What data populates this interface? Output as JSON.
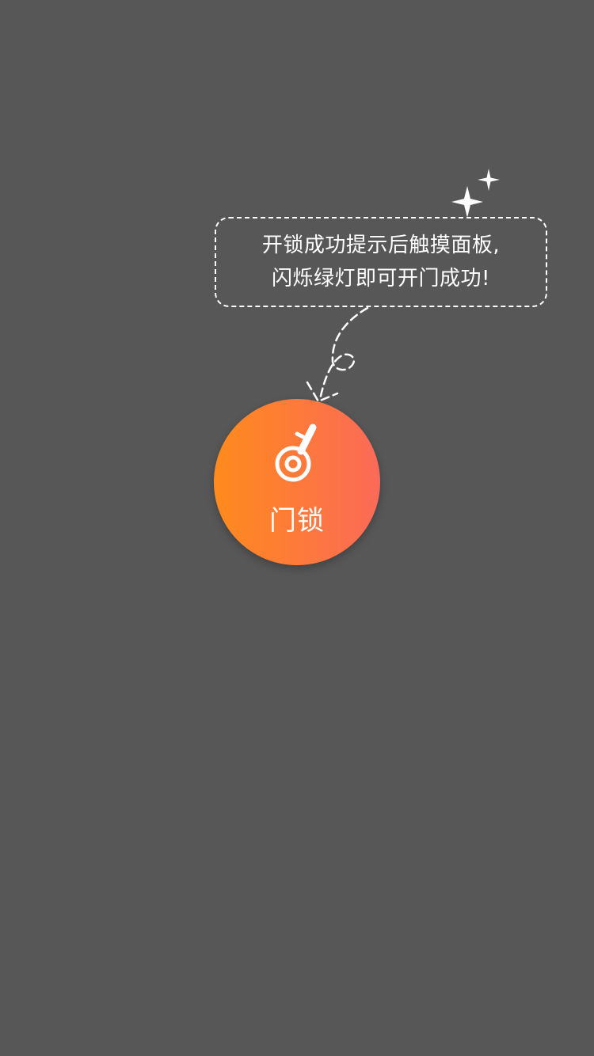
{
  "tip": {
    "line1": "开锁成功提示后触摸面板,",
    "line2": "闪烁绿灯即可开门成功!"
  },
  "lock_button": {
    "label": "门锁",
    "icon": "key-icon",
    "gradient_start": "#ff8a1c",
    "gradient_end": "#fb6a58"
  },
  "colors": {
    "background": "#575757",
    "foreground": "#ffffff"
  },
  "icons": {
    "sparkles": "sparkle-icon",
    "arrow": "dashed-curved-arrow-icon"
  }
}
